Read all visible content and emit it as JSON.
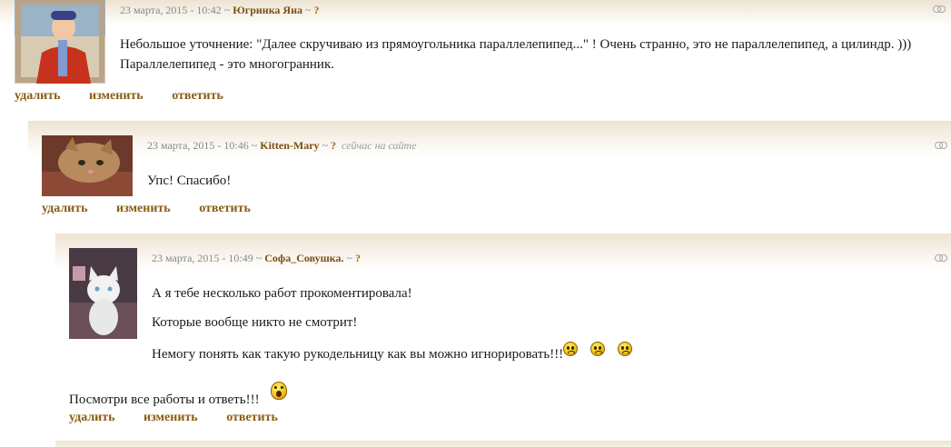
{
  "comments": [
    {
      "date": "23 марта, 2015 - 10:42",
      "sep1": " ~ ",
      "author": "Югринка Яна",
      "sep2": " ~ ",
      "q": "?",
      "online": "",
      "lines": [
        "Небольшое уточнение: \"Далее скручиваю из прямоугольника параллелепипед...\"    ! Очень странно, это не параллелепипед, а цилиндр. ))) Параллелепипед -  это многогранник."
      ]
    },
    {
      "date": "23 марта, 2015 - 10:46",
      "sep1": " ~ ",
      "author": "Kitten-Mary",
      "sep2": " ~ ",
      "q": "?",
      "online": "сейчас на сайте",
      "lines": [
        "Упс! Спасибо!"
      ]
    },
    {
      "date": "23 марта, 2015 - 10:49",
      "sep1": " ~ ",
      "author": "Софа_Совушка.",
      "sep2": " ~ ",
      "q": "?",
      "online": "",
      "lines": [
        "А я тебе несколько работ прокоментировала!",
        "Которые вообще никто не смотрит!",
        "Немогу понять как такую рукодельницу как вы можно игнорировать!!!",
        "Посмотри все работы и ответь!!!"
      ]
    }
  ],
  "actions": {
    "delete": "удалить",
    "edit": "изменить",
    "reply": "ответить"
  },
  "icons": {
    "permalink": "link-icon",
    "smiley": "smiley-icon",
    "shocked": "shocked-smiley-icon"
  }
}
